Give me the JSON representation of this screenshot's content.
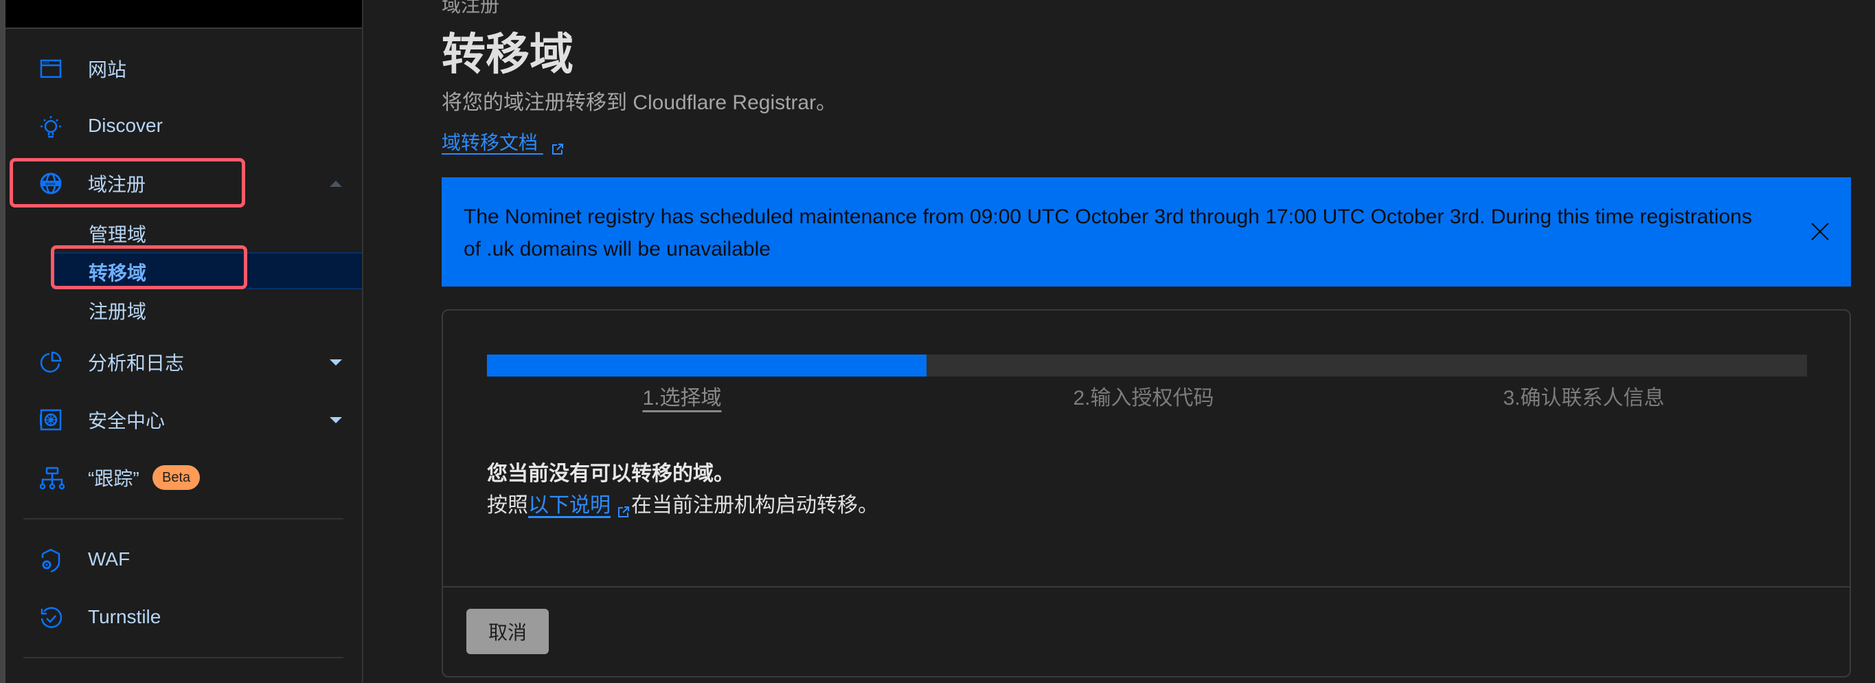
{
  "sidebar": {
    "items": [
      {
        "label": "网站",
        "icon": "browser-window-icon"
      },
      {
        "label": "Discover",
        "icon": "lightbulb-icon"
      },
      {
        "label": "域注册",
        "icon": "globe-www-icon",
        "expanded": true
      },
      {
        "label": "分析和日志",
        "icon": "pie-chart-icon"
      },
      {
        "label": "安全中心",
        "icon": "safe-vault-icon"
      },
      {
        "label": "“跟踪”",
        "icon": "network-tree-icon",
        "badge": "Beta"
      },
      {
        "label": "WAF",
        "icon": "shield-gear-icon"
      },
      {
        "label": "Turnstile",
        "icon": "refresh-check-icon"
      }
    ],
    "sub_items": [
      {
        "label": "管理域"
      },
      {
        "label": "转移域",
        "selected": true
      },
      {
        "label": "注册域"
      }
    ]
  },
  "header": {
    "breadcrumb": "域注册",
    "title": "转移域",
    "subtitle": "将您的域注册转移到 Cloudflare Registrar。",
    "doc_link": "域转移文档"
  },
  "banner": {
    "text": "The Nominet registry has scheduled maintenance from 09:00 UTC October 3rd through 17:00 UTC October 3rd. During this time registrations of .uk domains will be unavailable",
    "color": "#0070f3"
  },
  "wizard": {
    "progress": 0.333,
    "steps": [
      "1.选择域",
      "2.输入授权代码",
      "3.确认联系人信息"
    ],
    "active_step": 1,
    "message_title": "您当前没有可以转移的域。",
    "message_prefix": "按照",
    "message_link": "以下说明",
    "message_suffix": "在当前注册机构启动转移。",
    "cancel_label": "取消"
  },
  "colors": {
    "accent": "#0070f3",
    "highlight": "#ff5a67",
    "beta_badge": "#ff9b56"
  }
}
